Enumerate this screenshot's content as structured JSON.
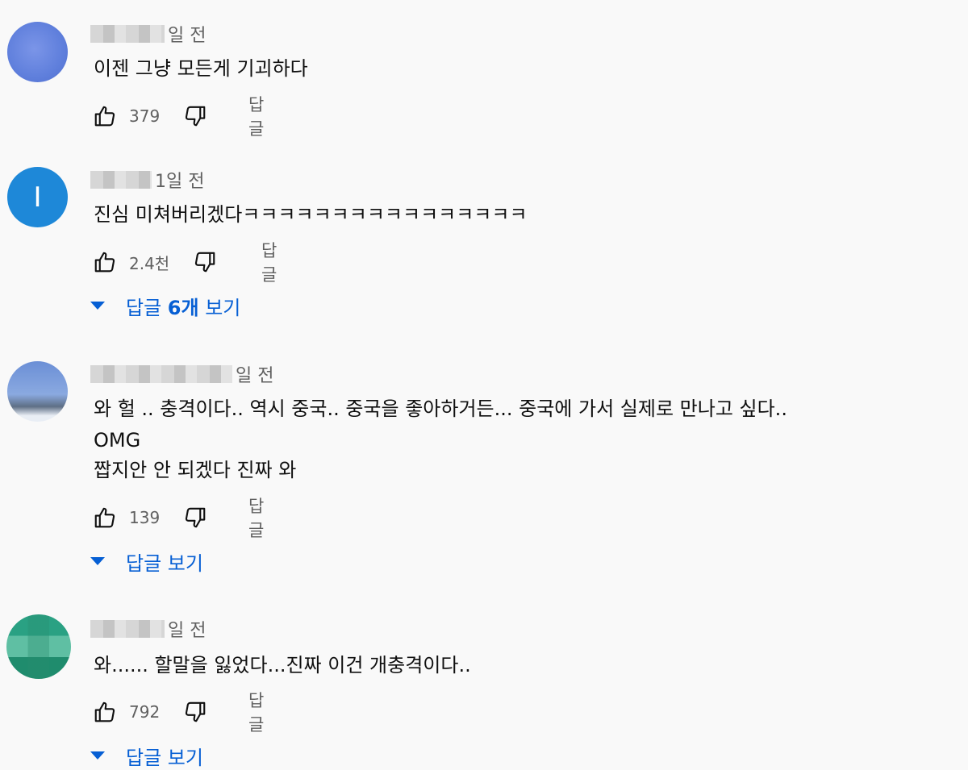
{
  "comments": [
    {
      "time": "일 전",
      "text": "이젠 그냥 모든게 기괴하다",
      "likes": "379",
      "reply_label": "답글"
    },
    {
      "avatar_letter": "I",
      "time": "1일 전",
      "text": "진심 미쳐버리겠다ㅋㅋㅋㅋㅋㅋㅋㅋㅋㅋㅋㅋㅋㅋㅋㅋ",
      "likes": "2.4천",
      "reply_label": "답글",
      "view_replies_prefix": "답글 ",
      "view_replies_count": "6개",
      "view_replies_suffix": " 보기"
    },
    {
      "time": "일 전",
      "text_lines": [
        "와 헐 ..  충격이다.. 역시 중국.. 중국을 좋아하거든... 중국에 가서 실제로 만나고 싶다..",
        "OMG",
        "짭지안 안 되겠다 진짜 와"
      ],
      "likes": "139",
      "reply_label": "답글",
      "view_replies": "답글 보기"
    },
    {
      "time": "일 전",
      "text": "와...... 할말을 잃었다...진짜 이건 개충격이다..",
      "likes": "792",
      "reply_label": "답글",
      "view_replies": "답글 보기"
    }
  ],
  "icons": {
    "like": "thumbs-up-icon",
    "dislike": "thumbs-down-icon",
    "expand": "caret-down-icon"
  },
  "colors": {
    "link": "#065fd4",
    "muted": "#606060",
    "background": "#f9f9f9"
  }
}
